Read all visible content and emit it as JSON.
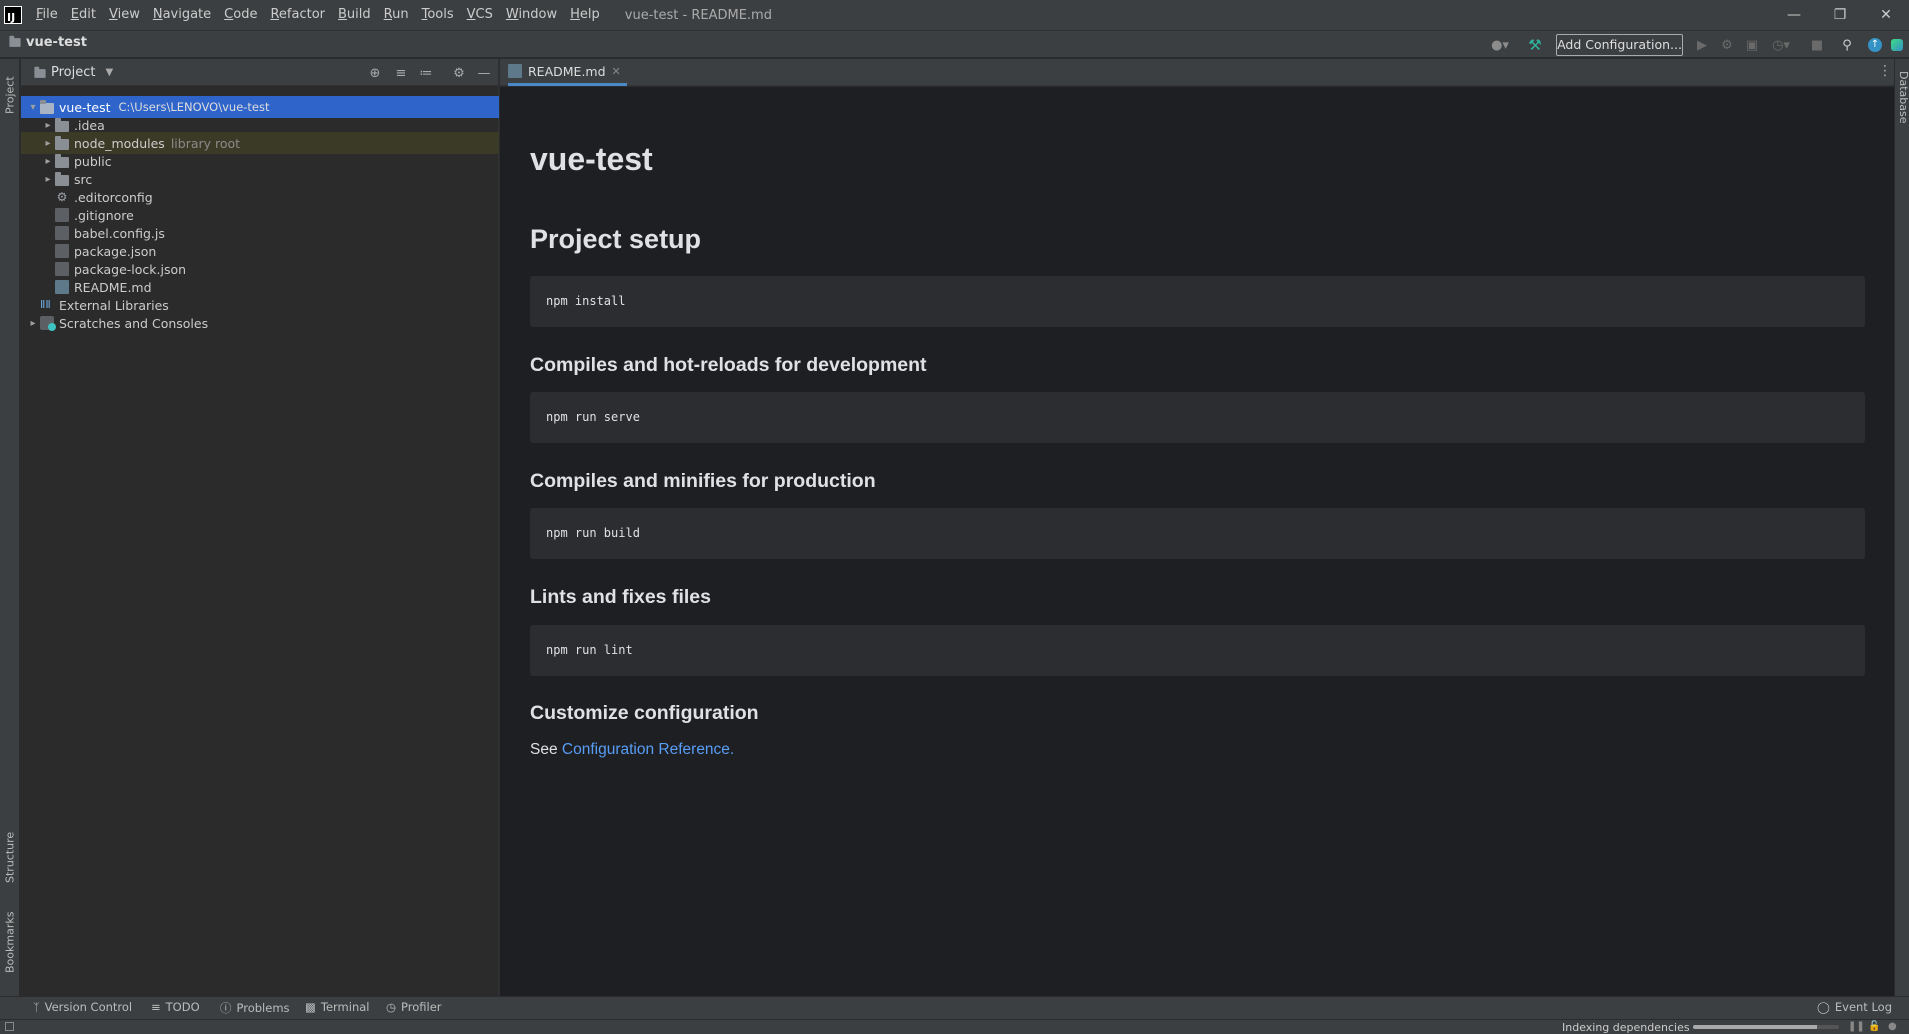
{
  "window": {
    "title": "vue-test - README.md"
  },
  "menu": [
    {
      "label": "File",
      "mnemonic": "F",
      "rest": "ile"
    },
    {
      "label": "Edit",
      "mnemonic": "E",
      "rest": "dit"
    },
    {
      "label": "View",
      "mnemonic": "V",
      "rest": "iew"
    },
    {
      "label": "Navigate",
      "mnemonic": "N",
      "rest": "avigate"
    },
    {
      "label": "Code",
      "mnemonic": "C",
      "rest": "ode"
    },
    {
      "label": "Refactor",
      "mnemonic": "R",
      "rest": "efactor"
    },
    {
      "label": "Build",
      "mnemonic": "B",
      "rest": "uild"
    },
    {
      "label": "Run",
      "mnemonic": "R",
      "rest": "un"
    },
    {
      "label": "Tools",
      "mnemonic": "T",
      "rest": "ools"
    },
    {
      "label": "VCS",
      "mnemonic": "V",
      "rest": "CS"
    },
    {
      "label": "Window",
      "mnemonic": "W",
      "rest": "indow"
    },
    {
      "label": "Help",
      "mnemonic": "H",
      "rest": "elp"
    }
  ],
  "navbar": {
    "project": "vue-test",
    "add_configuration": "Add Configuration..."
  },
  "left_strip": {
    "project_tab": "Project",
    "structure_tab": "Structure",
    "bookmarks_tab": "Bookmarks"
  },
  "right_strip": {
    "database_tab": "Database"
  },
  "project_panel": {
    "title": "Project",
    "tree": [
      {
        "name": "vue-test",
        "hint": "C:\\Users\\LENOVO\\vue-test",
        "kind": "root"
      },
      {
        "name": ".idea",
        "kind": "folder"
      },
      {
        "name": "node_modules",
        "hint": "library root",
        "kind": "library"
      },
      {
        "name": "public",
        "kind": "folder"
      },
      {
        "name": "src",
        "kind": "folder"
      },
      {
        "name": ".editorconfig",
        "kind": "config"
      },
      {
        "name": ".gitignore",
        "kind": "file"
      },
      {
        "name": "babel.config.js",
        "kind": "file"
      },
      {
        "name": "package.json",
        "kind": "file"
      },
      {
        "name": "package-lock.json",
        "kind": "file"
      },
      {
        "name": "README.md",
        "kind": "md"
      },
      {
        "name": "External Libraries",
        "kind": "libraries"
      },
      {
        "name": "Scratches and Consoles",
        "kind": "scratches"
      }
    ]
  },
  "editor": {
    "tab_label": "README.md",
    "markdown": {
      "h1": "vue-test",
      "h2_setup": "Project setup",
      "code_install": "npm install",
      "h3_dev": "Compiles and hot-reloads for development",
      "code_serve": "npm run serve",
      "h3_prod": "Compiles and minifies for production",
      "code_build": "npm run build",
      "h3_lint": "Lints and fixes files",
      "code_lint": "npm run lint",
      "h3_custom": "Customize configuration",
      "see_prefix": "See",
      "link_text": "Configuration Reference."
    }
  },
  "bottom_tools": {
    "version_control": "Version Control",
    "todo": "TODO",
    "problems": "Problems",
    "terminal": "Terminal",
    "profiler": "Profiler",
    "event_log": "Event Log"
  },
  "status": {
    "indexing": "Indexing dependencies",
    "progress": 0.85
  },
  "colors": {
    "selection": "#2f65ca",
    "link": "#589df6",
    "build_hammer": "#2fb5a0",
    "update_badge": "#3592c4"
  }
}
